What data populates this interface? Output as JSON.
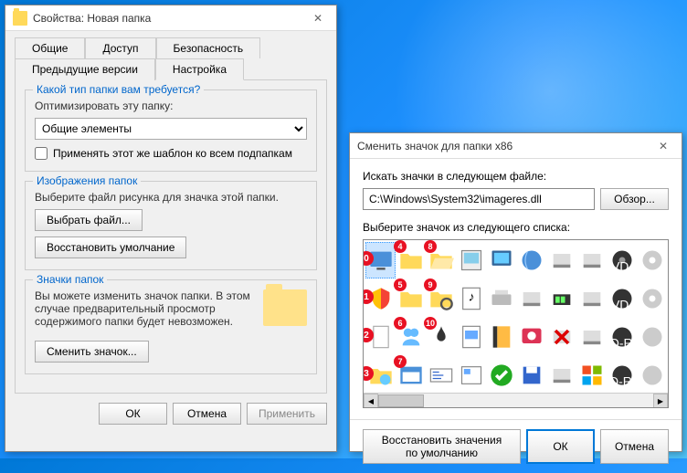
{
  "props_window": {
    "title": "Свойства: Новая папка",
    "tabs": {
      "general": "Общие",
      "access": "Доступ",
      "security": "Безопасность",
      "previous": "Предыдущие версии",
      "customize": "Настройка"
    },
    "folder_type": {
      "title": "Какой тип папки вам требуется?",
      "optimize_label": "Оптимизировать эту папку:",
      "combo_value": "Общие элементы",
      "apply_checkbox": "Применять этот же шаблон ко всем подпапкам"
    },
    "folder_images": {
      "title": "Изображения папок",
      "desc": "Выберите файл рисунка для значка этой папки.",
      "choose_btn": "Выбрать файл...",
      "restore_btn": "Восстановить умолчание"
    },
    "folder_icons": {
      "title": "Значки папок",
      "desc": "Вы можете изменить значок папки. В этом случае предварительный просмотр содержимого папки будет невозможен.",
      "change_btn": "Сменить значок..."
    },
    "buttons": {
      "ok": "ОК",
      "cancel": "Отмена",
      "apply": "Применить"
    }
  },
  "icon_dialog": {
    "title": "Сменить значок для папки x86",
    "search_label": "Искать значки в следующем файле:",
    "path_value": "C:\\Windows\\System32\\imageres.dll",
    "browse_btn": "Обзор...",
    "list_label": "Выберите значок из следующего списка:",
    "restore_btn": "Восстановить значения по умолчанию",
    "ok_btn": "ОК",
    "cancel_btn": "Отмена",
    "row_markers": [
      "0",
      "1",
      "2",
      "3"
    ],
    "cell_markers": [
      "4",
      "5",
      "6",
      "7",
      "8",
      "9",
      "10"
    ]
  }
}
